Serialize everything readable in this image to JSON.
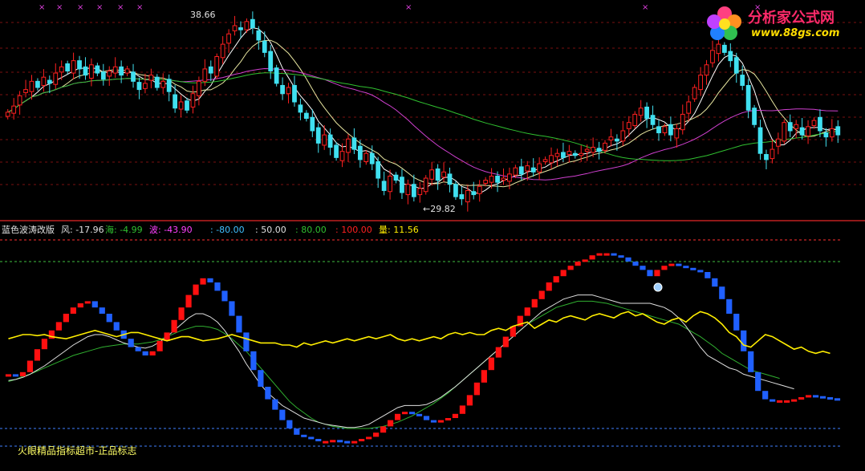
{
  "logo": {
    "title": "分析家公式网",
    "url": "www.88gs.com"
  },
  "footer_text": "火眼精品指标超市-正品标志",
  "colors": {
    "up": "#ff2020",
    "down": "#40e0f0",
    "ma_short": "#ffffff",
    "ma_mid": "#e8e6a0",
    "ma_long": "#d040d0",
    "ma_longest": "#30c030",
    "divider": "#c02020",
    "ind_red": "#ff1010",
    "ind_blue": "#2060ff",
    "ind_yellow": "#ffee00",
    "ind_white": "#e0e0e0",
    "ind_green": "#30b030",
    "ref_line": "#40c040",
    "ref_line_low": "#4080ff"
  },
  "chart_data": [
    {
      "type": "candlestick",
      "panel": "price",
      "high_marker": "38.66",
      "low_marker": "←29.82",
      "close": [
        34.1,
        34.4,
        34.9,
        35.2,
        35.6,
        35.3,
        35.8,
        35.5,
        36.0,
        36.3,
        36.1,
        36.6,
        36.2,
        35.9,
        36.4,
        36.0,
        35.7,
        36.1,
        36.3,
        35.9,
        36.2,
        35.6,
        35.2,
        35.5,
        35.9,
        35.3,
        35.6,
        35.1,
        34.3,
        34.6,
        34.2,
        35.0,
        35.6,
        36.2,
        36.0,
        36.8,
        37.4,
        37.9,
        38.3,
        38.1,
        38.5,
        38.2,
        37.6,
        37.0,
        36.1,
        35.5,
        35.0,
        35.3,
        34.6,
        34.1,
        33.8,
        33.2,
        32.6,
        33.0,
        32.4,
        31.9,
        32.2,
        32.8,
        32.3,
        31.8,
        32.1,
        31.6,
        30.9,
        30.3,
        31.0,
        30.8,
        30.2,
        30.6,
        30.0,
        30.4,
        30.9,
        31.3,
        30.8,
        31.2,
        30.6,
        30.0,
        29.9,
        30.3,
        30.1,
        30.5,
        30.8,
        31.0,
        30.7,
        30.9,
        31.1,
        31.4,
        31.1,
        31.5,
        31.2,
        31.6,
        31.8,
        32.0,
        32.1,
        31.9,
        32.2,
        32.0,
        32.1,
        32.3,
        32.4,
        32.2,
        32.6,
        32.9,
        32.7,
        33.2,
        33.6,
        34.0,
        34.3,
        33.8,
        33.5,
        33.1,
        33.4,
        33.0,
        33.3,
        34.0,
        34.6,
        35.3,
        35.9,
        36.4,
        37.1,
        37.4,
        37.0,
        36.6,
        36.0,
        35.4,
        34.2,
        33.5,
        32.1,
        31.8,
        32.3,
        32.8,
        33.6,
        33.2,
        33.5,
        33.0,
        33.4,
        33.7,
        33.2,
        32.9,
        33.3,
        33.0
      ]
    },
    {
      "type": "indicator",
      "panel": "oscillator",
      "title": "蓝色波涛改版",
      "legend": [
        {
          "name": "风",
          "value": "-17.96"
        },
        {
          "name": "海",
          "value": "-4.99"
        },
        {
          "name": "波",
          "value": "-43.90"
        }
      ],
      "ref_levels": [
        {
          "label": ": -80.00",
          "value": -80
        },
        {
          "label": ": 50.00",
          "value": 50
        },
        {
          "label": ": 80.00",
          "value": 80
        },
        {
          "label": ": 100.00",
          "value": 100
        }
      ],
      "volume_label": "量",
      "volume_value": "11.56",
      "ylim": [
        -100,
        100
      ],
      "wave": [
        -28,
        -30,
        -26,
        -15,
        -4,
        6,
        14,
        22,
        30,
        36,
        40,
        42,
        36,
        30,
        22,
        14,
        6,
        -2,
        -6,
        -10,
        -6,
        4,
        12,
        24,
        36,
        48,
        58,
        64,
        60,
        52,
        42,
        28,
        12,
        -6,
        -24,
        -40,
        -52,
        -62,
        -72,
        -80,
        -86,
        -88,
        -90,
        -92,
        -92,
        -91,
        -92,
        -94,
        -92,
        -90,
        -88,
        -84,
        -78,
        -72,
        -66,
        -64,
        -66,
        -68,
        -72,
        -74,
        -72,
        -70,
        -66,
        -58,
        -48,
        -36,
        -24,
        -12,
        -2,
        8,
        18,
        28,
        36,
        44,
        52,
        60,
        66,
        72,
        76,
        80,
        82,
        86,
        88,
        88,
        86,
        84,
        80,
        76,
        72,
        66,
        72,
        76,
        78,
        76,
        74,
        72,
        70,
        64,
        56,
        44,
        30,
        14,
        -6,
        -26,
        -44,
        -52,
        -54,
        -53,
        -53,
        -52,
        -50,
        -48,
        -49,
        -50,
        -51,
        -52
      ],
      "wind": [
        -34,
        -33,
        -31,
        -28,
        -24,
        -20,
        -15,
        -10,
        -5,
        0,
        4,
        8,
        10,
        10,
        8,
        5,
        2,
        0,
        -2,
        -3,
        -1,
        3,
        8,
        14,
        20,
        26,
        30,
        30,
        27,
        22,
        14,
        4,
        -6,
        -18,
        -28,
        -38,
        -46,
        -52,
        -58,
        -62,
        -66,
        -70,
        -72,
        -74,
        -76,
        -77,
        -78,
        -79,
        -79,
        -78,
        -76,
        -72,
        -68,
        -64,
        -60,
        -58,
        -58,
        -58,
        -57,
        -54,
        -50,
        -45,
        -40,
        -34,
        -28,
        -22,
        -16,
        -10,
        -4,
        2,
        8,
        14,
        20,
        26,
        32,
        36,
        40,
        44,
        46,
        48,
        48,
        48,
        46,
        44,
        42,
        40,
        40,
        40,
        40,
        40,
        38,
        36,
        32,
        26,
        18,
        8,
        -2,
        -10,
        -14,
        -18,
        -22,
        -24,
        -28,
        -30,
        -32,
        -34,
        -36,
        -38,
        -40,
        -42
      ],
      "sea": [
        -35,
        -33,
        -30,
        -28,
        -25,
        -22,
        -19,
        -16,
        -13,
        -10,
        -8,
        -6,
        -4,
        -2,
        -1,
        0,
        1,
        1,
        1,
        2,
        3,
        5,
        8,
        11,
        14,
        16,
        18,
        18,
        17,
        15,
        11,
        6,
        0,
        -6,
        -14,
        -22,
        -30,
        -38,
        -46,
        -54,
        -60,
        -65,
        -70,
        -74,
        -76,
        -78,
        -79,
        -80,
        -80,
        -80,
        -80,
        -79,
        -78,
        -76,
        -74,
        -71,
        -68,
        -64,
        -60,
        -56,
        -51,
        -46,
        -40,
        -34,
        -28,
        -22,
        -16,
        -10,
        -4,
        2,
        8,
        14,
        20,
        24,
        28,
        32,
        36,
        38,
        40,
        42,
        42,
        42,
        41,
        40,
        38,
        36,
        34,
        32,
        30,
        28,
        26,
        24,
        22,
        20,
        16,
        12,
        8,
        3,
        -2,
        -8,
        -12,
        -16,
        -20,
        -24,
        -26,
        -28,
        -30,
        -32
      ],
      "sea_start_index": 0,
      "haiwave": [
        6,
        8,
        10,
        10,
        9,
        10,
        8,
        7,
        6,
        8,
        10,
        12,
        14,
        12,
        10,
        8,
        10,
        12,
        12,
        10,
        8,
        6,
        4,
        6,
        8,
        8,
        6,
        4,
        5,
        6,
        8,
        10,
        8,
        6,
        4,
        2,
        2,
        2,
        0,
        0,
        -2,
        2,
        0,
        2,
        4,
        2,
        4,
        6,
        4,
        6,
        8,
        6,
        8,
        10,
        6,
        4,
        6,
        4,
        6,
        8,
        6,
        10,
        12,
        10,
        12,
        10,
        10,
        14,
        16,
        14,
        18,
        20,
        22,
        16,
        20,
        24,
        22,
        26,
        28,
        26,
        24,
        28,
        30,
        28,
        26,
        30,
        32,
        28,
        30,
        26,
        22,
        20,
        24,
        26,
        22,
        28,
        32,
        30,
        26,
        20,
        12,
        8,
        0,
        -2,
        4,
        10,
        8,
        4,
        0,
        -4,
        -2,
        -6,
        -8,
        -6,
        -8
      ]
    }
  ]
}
